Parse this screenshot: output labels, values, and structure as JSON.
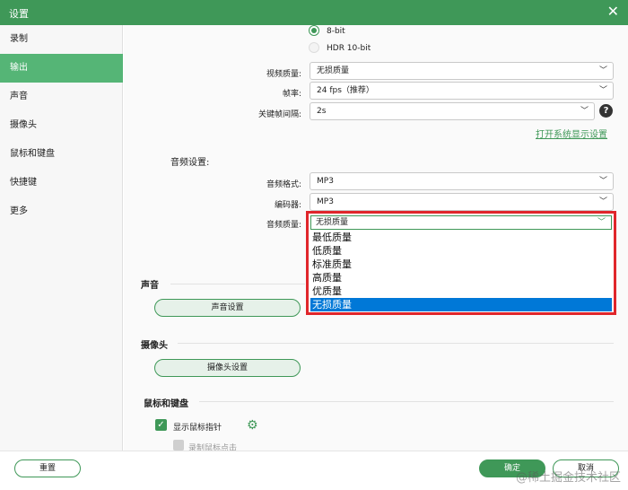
{
  "window": {
    "title": "设置",
    "close_glyph": "✕"
  },
  "sidebar": {
    "items": [
      {
        "label": "录制"
      },
      {
        "label": "输出",
        "active": true
      },
      {
        "label": "声音"
      },
      {
        "label": "摄像头"
      },
      {
        "label": "鼠标和键盘"
      },
      {
        "label": "快捷键"
      },
      {
        "label": "更多"
      }
    ]
  },
  "video": {
    "color_depth": {
      "option_8bit": "8-bit",
      "option_hdr": "HDR 10-bit",
      "selected": "8-bit"
    },
    "quality": {
      "label": "视频质量:",
      "value": "无损质量"
    },
    "framerate": {
      "label": "帧率:",
      "value": "24 fps（推荐）"
    },
    "keyframe": {
      "label": "关键帧间隔:",
      "value": "2s"
    },
    "help_glyph": "?",
    "display_settings_link": "打开系统显示设置"
  },
  "audio": {
    "section_label": "音频设置:",
    "format": {
      "label": "音频格式:",
      "value": "MP3"
    },
    "encoder": {
      "label": "编码器:",
      "value": "MP3"
    },
    "quality": {
      "label": "音频质量:",
      "value": "无损质量",
      "options": [
        "最低质量",
        "低质量",
        "标准质量",
        "高质量",
        "优质量",
        "无损质量"
      ],
      "selected": "无损质量"
    }
  },
  "sound_section": {
    "title": "声音",
    "button": "声音设置"
  },
  "camera_section": {
    "title": "摄像头",
    "button": "摄像头设置"
  },
  "mouse_section": {
    "title": "鼠标和键盘",
    "show_cursor": {
      "label": "显示鼠标指针",
      "checked": true
    },
    "record_clicks": {
      "label": "录制鼠标点击"
    }
  },
  "footer": {
    "reset": "重置",
    "ok": "确定",
    "cancel": "取消"
  },
  "watermark": "@稀土掘金技术社区",
  "colors": {
    "accent": "#3f9858",
    "sidebar_active": "#55b576",
    "highlight_border": "#e0262b",
    "selection": "#0078d7"
  }
}
